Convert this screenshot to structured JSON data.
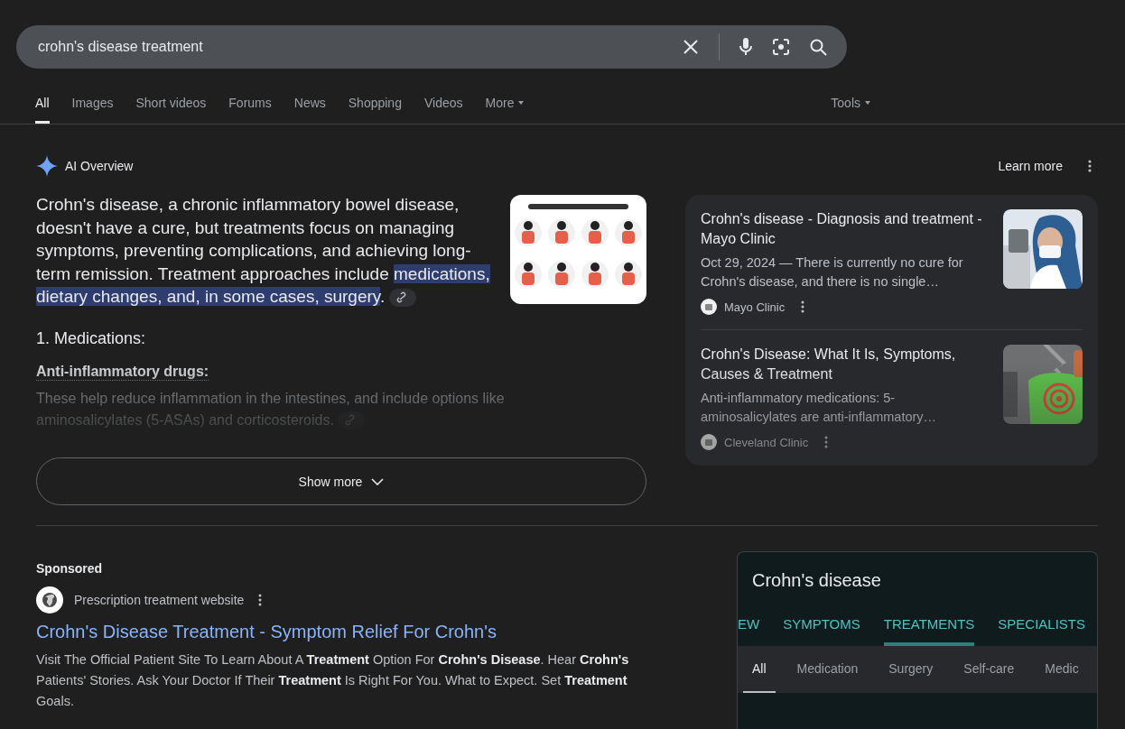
{
  "search": {
    "value": "crohn's disease treatment"
  },
  "tabs": [
    {
      "label": "All",
      "selected": true
    },
    {
      "label": "Images",
      "selected": false
    },
    {
      "label": "Short videos",
      "selected": false
    },
    {
      "label": "Forums",
      "selected": false
    },
    {
      "label": "News",
      "selected": false
    },
    {
      "label": "Shopping",
      "selected": false
    },
    {
      "label": "Videos",
      "selected": false
    },
    {
      "label": "More",
      "selected": false,
      "dropdown": true
    }
  ],
  "tools": {
    "label": "Tools"
  },
  "ai_overview": {
    "title": "AI Overview",
    "learn_more": "Learn more",
    "summary": {
      "before": "Crohn's disease, a chronic inflammatory bowel disease, doesn't have a cure, but treatments focus on managing symptoms, preventing complications, and achieving long-term remission. Treatment approaches include ",
      "highlight": "medications, dietary changes, and, in some cases, surgery",
      "after": "."
    },
    "heading": "1. Medications:",
    "subheading": "Anti-inflammatory drugs:",
    "detail": "These help reduce inflammation in the intestines, and include options like aminosalicylates (5-ASAs) and corticosteroids.",
    "show_more": "Show more",
    "sources": [
      {
        "title": "Crohn's disease - Diagnosis and treatment - Mayo Clinic",
        "snippet": "Oct 29, 2024 — There is currently no cure for Crohn's disease, and there is no single…",
        "site": "Mayo Clinic"
      },
      {
        "title": "Crohn's Disease: What It Is, Symptoms, Causes & Treatment",
        "snippet": "Anti-inflammatory medications: 5-aminosalicylates are anti-inflammatory…",
        "site": "Cleveland Clinic"
      }
    ]
  },
  "ad": {
    "label": "Sponsored",
    "site": "Prescription treatment website",
    "title": "Crohn's Disease Treatment - Symptom Relief For Crohn's",
    "description": "Visit The Official Patient Site To Learn About A **Treatment** Option For **Crohn's Disease**. Hear **Crohn's** Patients' Stories. Ask Your Doctor If Their **Treatment** Is Right For You. What to Expect. Set **Treatment** Goals."
  },
  "knowledge_panel": {
    "title": "Crohn's disease",
    "tabs": [
      {
        "label": "EW",
        "selected": false
      },
      {
        "label": "SYMPTOMS",
        "selected": false
      },
      {
        "label": "TREATMENTS",
        "selected": true
      },
      {
        "label": "SPECIALISTS",
        "selected": false
      }
    ],
    "chips": [
      {
        "label": "All",
        "selected": true
      },
      {
        "label": "Medication",
        "selected": false
      },
      {
        "label": "Surgery",
        "selected": false
      },
      {
        "label": "Self-care",
        "selected": false
      },
      {
        "label": "Medic",
        "selected": false
      }
    ]
  }
}
